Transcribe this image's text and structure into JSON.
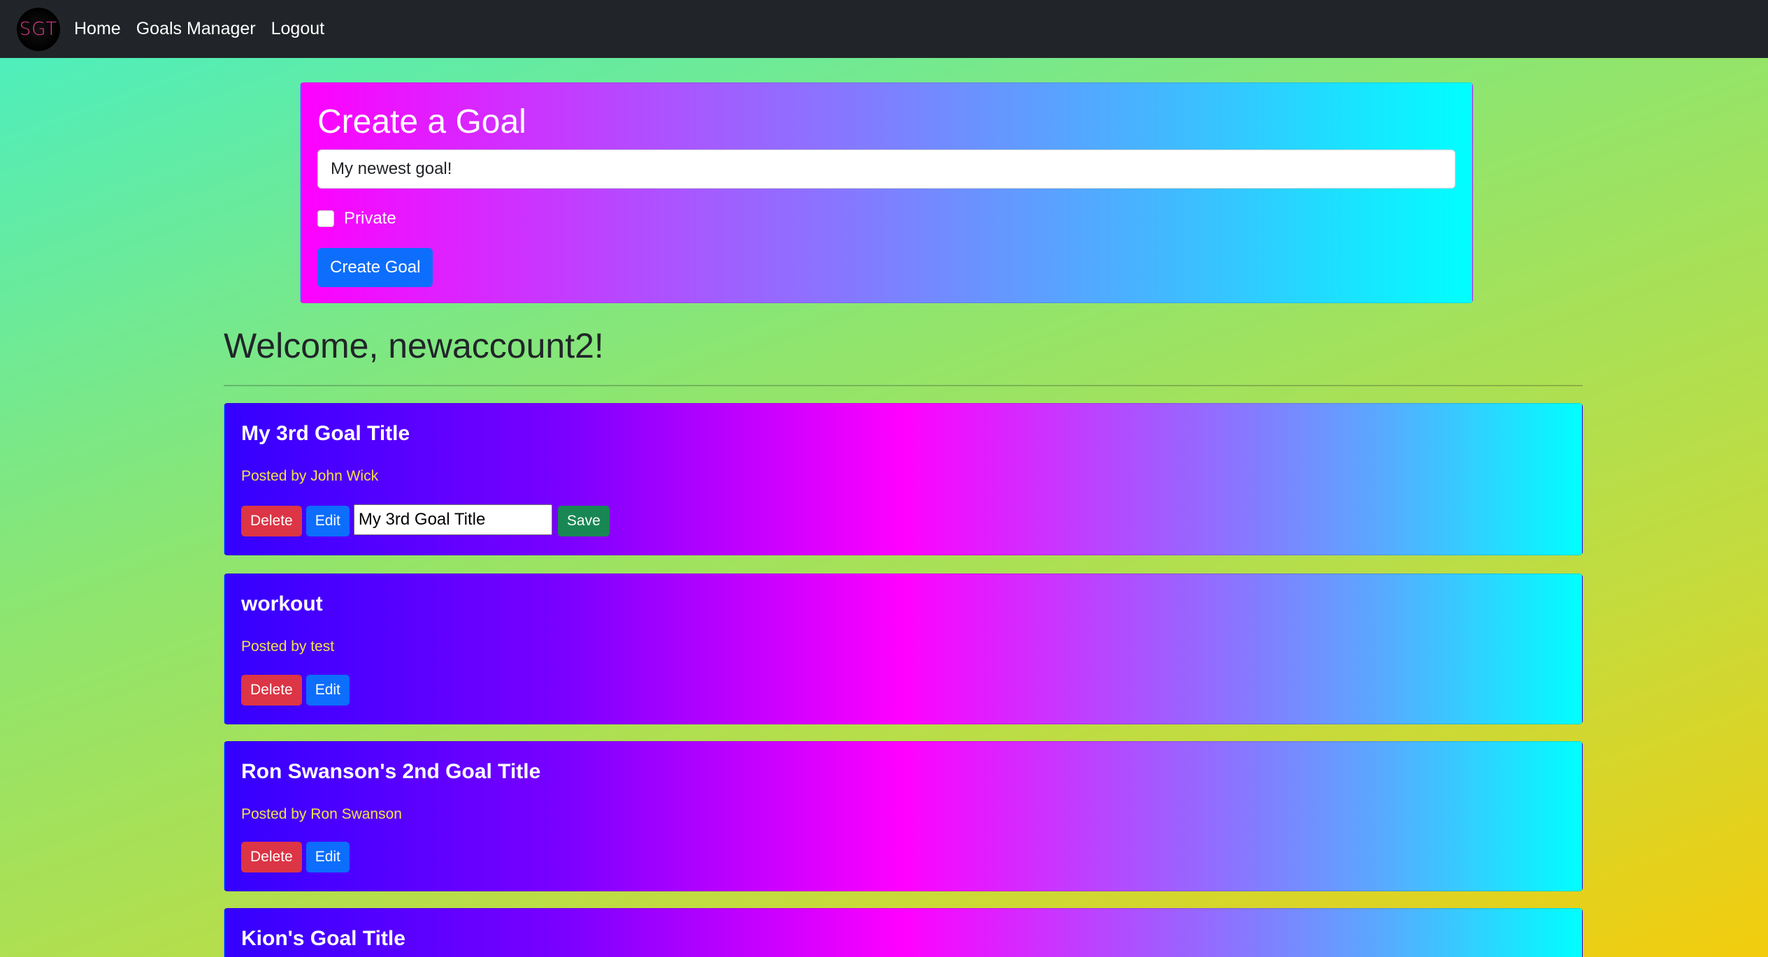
{
  "navbar": {
    "logo_text": "SGT",
    "links": [
      "Home",
      "Goals Manager",
      "Logout"
    ]
  },
  "create_goal": {
    "title": "Create a Goal",
    "input_value": "My newest goal!",
    "private_label": "Private",
    "button_label": "Create Goal"
  },
  "welcome": "Welcome, newaccount2!",
  "goals": [
    {
      "title": "My 3rd Goal Title",
      "posted_by": "Posted by John Wick",
      "delete_label": "Delete",
      "edit_label": "Edit",
      "edit_value": "My 3rd Goal Title",
      "save_label": "Save"
    },
    {
      "title": "workout",
      "posted_by": "Posted by test",
      "delete_label": "Delete",
      "edit_label": "Edit"
    },
    {
      "title": "Ron Swanson's 2nd Goal Title",
      "posted_by": "Posted by Ron Swanson",
      "delete_label": "Delete",
      "edit_label": "Edit"
    },
    {
      "title": "Kion's Goal Title"
    }
  ],
  "colors": {
    "navbar_bg": "#212529",
    "primary": "#0d6efd",
    "danger": "#dc3545",
    "success": "#198754",
    "posted_by": "#f5e14a"
  }
}
